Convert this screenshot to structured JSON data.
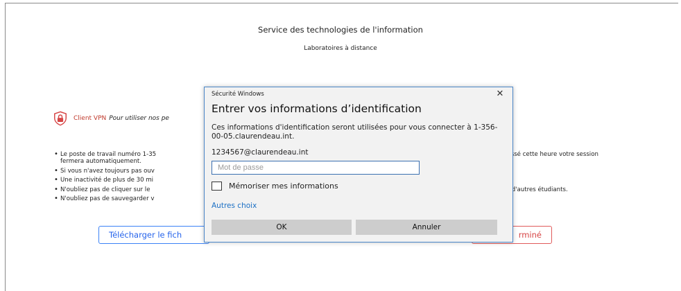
{
  "page": {
    "title": "Service des technologies de l'information",
    "subtitle": "Laboratoires à distance"
  },
  "vpn": {
    "icon": "shield-lock-icon",
    "name": "Client VPN",
    "description": "Pour utiliser nos pe",
    "accent_color": "#d64545"
  },
  "bullets": [
    "Le poste de travail numéro 1-35",
    "fermera automatiquement.",
    "Si vous n'avez toujours pas ouv",
    "Une inactivité de plus de 30 mi",
    "N'oubliez pas de cliquer sur le",
    "N'oubliez pas de sauvegarder v"
  ],
  "bullets_right": {
    "row1": "passé cette heure votre session",
    "row4": "ur d'autres étudiants."
  },
  "buttons": {
    "download": "Télécharger le fich",
    "done": "rminé"
  },
  "dialog": {
    "caption": "Sécurité Windows",
    "close": "✕",
    "heading": "Entrer vos informations d’identification",
    "description": "Ces informations d'identification seront utilisées pour vous connecter à 1-356-00-05.claurendeau.int.",
    "username": "1234567@claurendeau.int",
    "password_placeholder": "Mot de passe",
    "password_value": "",
    "remember_label": "Mémoriser mes informations",
    "remember_checked": false,
    "more_choices": "Autres choix",
    "ok_label": "OK",
    "cancel_label": "Annuler"
  }
}
